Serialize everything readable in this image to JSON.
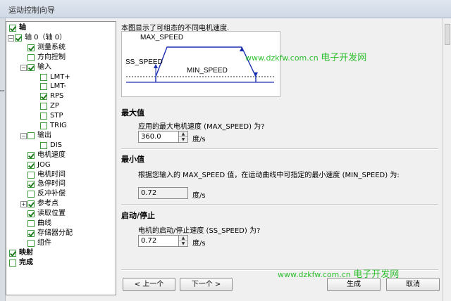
{
  "window": {
    "title": "运动控制向导"
  },
  "tree": [
    {
      "label": "轴",
      "level": 0,
      "checked": true,
      "bold": true
    },
    {
      "label": "轴 0（轴 0）",
      "level": 1,
      "checked": true,
      "expander": "−"
    },
    {
      "label": "测量系统",
      "level": 2,
      "checked": true
    },
    {
      "label": "方向控制",
      "level": 2,
      "checked": false
    },
    {
      "label": "输入",
      "level": 2,
      "checked": true,
      "expander": "−"
    },
    {
      "label": "LMT+",
      "level": 3,
      "checked": false
    },
    {
      "label": "LMT-",
      "level": 3,
      "checked": false
    },
    {
      "label": "RPS",
      "level": 3,
      "checked": true
    },
    {
      "label": "ZP",
      "level": 3,
      "checked": false
    },
    {
      "label": "STP",
      "level": 3,
      "checked": false
    },
    {
      "label": "TRIG",
      "level": 3,
      "checked": false
    },
    {
      "label": "输出",
      "level": 2,
      "checked": false,
      "expander": "−"
    },
    {
      "label": "DIS",
      "level": 3,
      "checked": false
    },
    {
      "label": "电机速度",
      "level": 2,
      "checked": true
    },
    {
      "label": "JOG",
      "level": 2,
      "checked": true
    },
    {
      "label": "电机时间",
      "level": 2,
      "checked": false
    },
    {
      "label": "急停时间",
      "level": 2,
      "checked": true
    },
    {
      "label": "反冲补偿",
      "level": 2,
      "checked": false
    },
    {
      "label": "参考点",
      "level": 2,
      "checked": true,
      "expander": "+"
    },
    {
      "label": "读取位置",
      "level": 2,
      "checked": true
    },
    {
      "label": "曲线",
      "level": 2,
      "checked": false
    },
    {
      "label": "存储器分配",
      "level": 2,
      "checked": true
    },
    {
      "label": "组件",
      "level": 2,
      "checked": false
    },
    {
      "label": "映射",
      "level": 0,
      "checked": true,
      "bold": true
    },
    {
      "label": "完成",
      "level": 0,
      "checked": false,
      "bold": true
    }
  ],
  "intro": "本图显示了可组态的不同电机速度.",
  "diagram": {
    "max_label": "MAX_SPEED",
    "ss_label": "SS_SPEED",
    "min_label": "MIN_SPEED"
  },
  "max_speed": {
    "title": "最大值",
    "prompt": "应用的最大电机速度 (MAX_SPEED) 为?",
    "value": "360.0",
    "unit": "度/s"
  },
  "min_speed": {
    "title": "最小值",
    "prompt": "根据您输入的 MAX_SPEED 值，在运动曲线中可指定的最小速度 (MIN_SPEED) 为:",
    "value": "0.72",
    "unit": "度/s"
  },
  "start_stop": {
    "title": "启动/停止",
    "prompt": "电机的启动/停止速度 (SS_SPEED) 为?",
    "value": "0.72",
    "unit": "度/s"
  },
  "buttons": {
    "prev": "< 上一个",
    "next": "下一个 >",
    "finish": "生成",
    "cancel": "取消"
  },
  "watermark": {
    "url": "www.dzkfw.com.cn",
    "text": "电子开发网"
  },
  "colors": {
    "check": "#1f7a1f",
    "watermark": "#2fbf2f",
    "curve": "#1a2fb0"
  }
}
